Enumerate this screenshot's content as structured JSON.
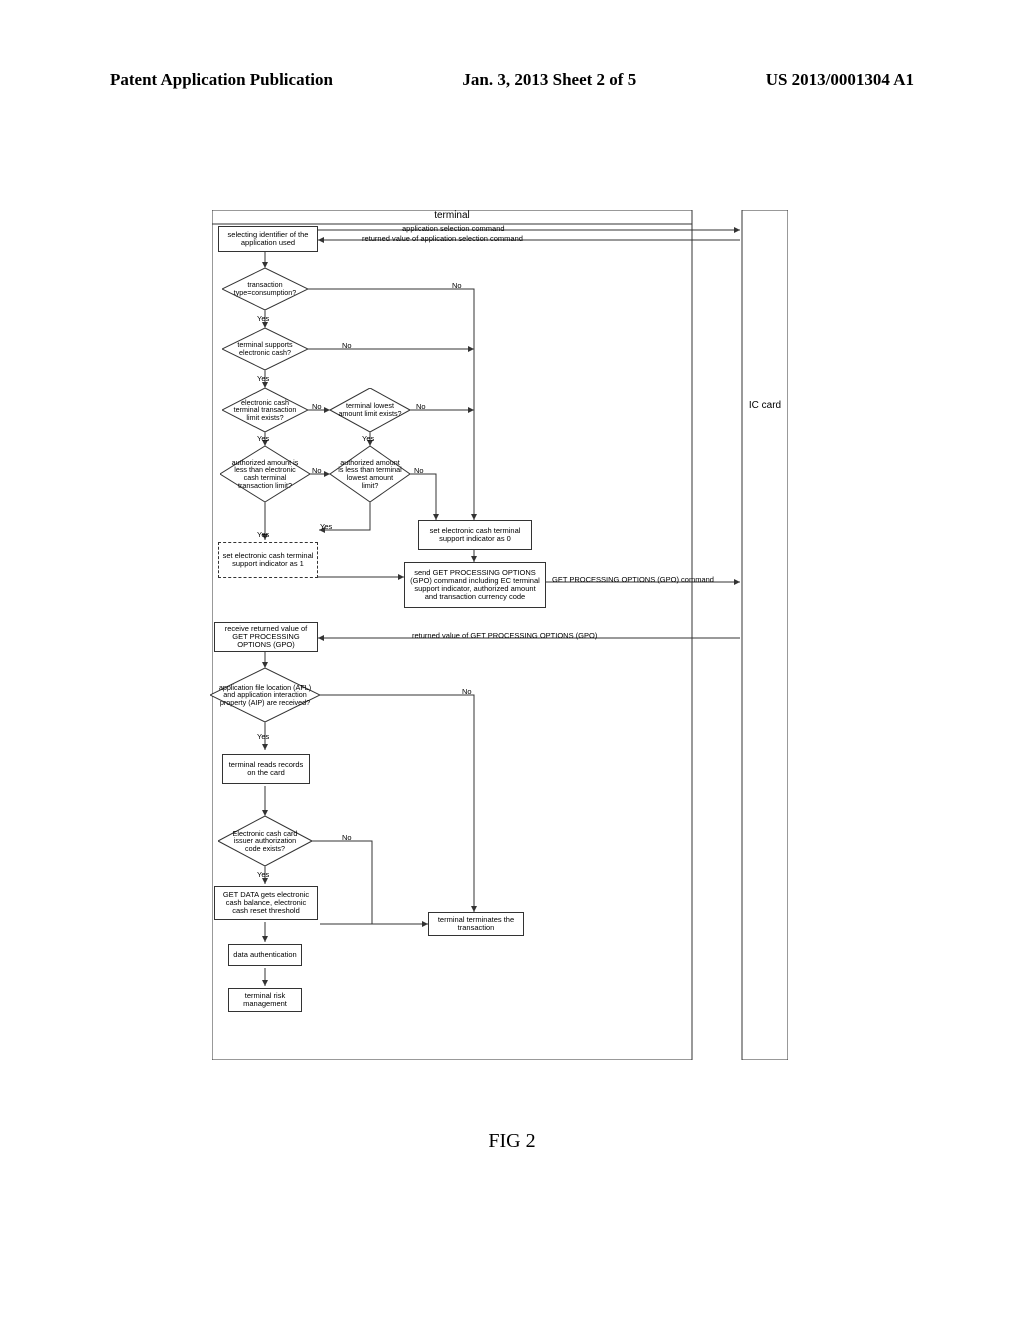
{
  "header": {
    "left": "Patent Application Publication",
    "center": "Jan. 3, 2013  Sheet 2 of 5",
    "right": "US 2013/0001304 A1"
  },
  "columns": {
    "terminal": "terminal",
    "iccard": "IC card"
  },
  "figure_label": "FIG 2",
  "arrows": {
    "app_select_cmd": "application selection command",
    "app_select_return": "returned value of application selection command",
    "gpo_cmd": "GET PROCESSING OPTIONS (GPO) command",
    "gpo_return": "returned value of GET PROCESSING OPTIONS (GPO)"
  },
  "labels": {
    "yes": "Yes",
    "no": "No"
  },
  "nodes": {
    "select_id": "selecting identifier of the application used",
    "tx_type": "transaction type=consumption?",
    "supports_ec": "terminal supports electronic cash?",
    "ec_limit_exists": "electronic cash terminal transaction limit exists?",
    "lowest_limit_exists": "terminal lowest amount limit exists?",
    "auth_less_ec": "authorized amount is less than electronic cash terminal transaction limit?",
    "auth_less_lowest": "authorized amount is less than terminal lowest amount limit?",
    "set_ind_1": "set electronic cash terminal support indicator as 1",
    "set_ind_0": "set electronic cash terminal support indicator as 0",
    "send_gpo": "send GET PROCESSING OPTIONS (GPO) command including EC terminal support indicator, authorized amount and transaction currency code",
    "recv_gpo": "receive returned value of GET PROCESSING OPTIONS (GPO)",
    "afl_aip": "application file location (AFL) and application interaction property (AIP) are received?",
    "read_records": "terminal reads records on the card",
    "ec_auth_code": "Electronic cash card issuer authorization code exists?",
    "get_data": "GET DATA gets electronic cash balance, electronic cash reset threshold",
    "terminate": "terminal terminates the transaction",
    "data_auth": "data authentication",
    "risk_mgmt": "terminal risk management"
  },
  "chart_data": {
    "type": "flowchart",
    "lanes": [
      "terminal",
      "IC card"
    ],
    "messages": [
      {
        "from": "terminal",
        "to": "IC card",
        "label": "application selection command"
      },
      {
        "from": "IC card",
        "to": "terminal",
        "label": "returned value of application selection command"
      },
      {
        "from": "terminal",
        "to": "IC card",
        "label": "GET PROCESSING OPTIONS (GPO) command"
      },
      {
        "from": "IC card",
        "to": "terminal",
        "label": "returned value of GET PROCESSING OPTIONS (GPO)"
      }
    ],
    "nodes": [
      {
        "id": "select_id",
        "type": "process",
        "lane": "terminal"
      },
      {
        "id": "tx_type",
        "type": "decision",
        "lane": "terminal",
        "yes": "supports_ec",
        "no": "set_ind_0"
      },
      {
        "id": "supports_ec",
        "type": "decision",
        "lane": "terminal",
        "yes": "ec_limit_exists",
        "no": "set_ind_0"
      },
      {
        "id": "ec_limit_exists",
        "type": "decision",
        "lane": "terminal",
        "yes": "auth_less_ec",
        "no": "lowest_limit_exists"
      },
      {
        "id": "lowest_limit_exists",
        "type": "decision",
        "lane": "terminal",
        "yes": "auth_less_lowest",
        "no": "set_ind_0"
      },
      {
        "id": "auth_less_ec",
        "type": "decision",
        "lane": "terminal",
        "yes": "set_ind_1",
        "no": "auth_less_lowest"
      },
      {
        "id": "auth_less_lowest",
        "type": "decision",
        "lane": "terminal",
        "yes": "set_ind_1",
        "no": "set_ind_0"
      },
      {
        "id": "set_ind_1",
        "type": "process",
        "lane": "terminal",
        "next": "send_gpo"
      },
      {
        "id": "set_ind_0",
        "type": "process",
        "lane": "terminal",
        "next": "send_gpo"
      },
      {
        "id": "send_gpo",
        "type": "process",
        "lane": "terminal",
        "next": "recv_gpo"
      },
      {
        "id": "recv_gpo",
        "type": "process",
        "lane": "terminal",
        "next": "afl_aip"
      },
      {
        "id": "afl_aip",
        "type": "decision",
        "lane": "terminal",
        "yes": "read_records",
        "no": "terminate"
      },
      {
        "id": "read_records",
        "type": "process",
        "lane": "terminal",
        "next": "ec_auth_code"
      },
      {
        "id": "ec_auth_code",
        "type": "decision",
        "lane": "terminal",
        "yes": "get_data",
        "no": "terminate"
      },
      {
        "id": "get_data",
        "type": "process",
        "lane": "terminal",
        "next": "data_auth"
      },
      {
        "id": "terminate",
        "type": "process",
        "lane": "terminal"
      },
      {
        "id": "data_auth",
        "type": "process",
        "lane": "terminal",
        "next": "risk_mgmt"
      },
      {
        "id": "risk_mgmt",
        "type": "process",
        "lane": "terminal"
      }
    ]
  }
}
